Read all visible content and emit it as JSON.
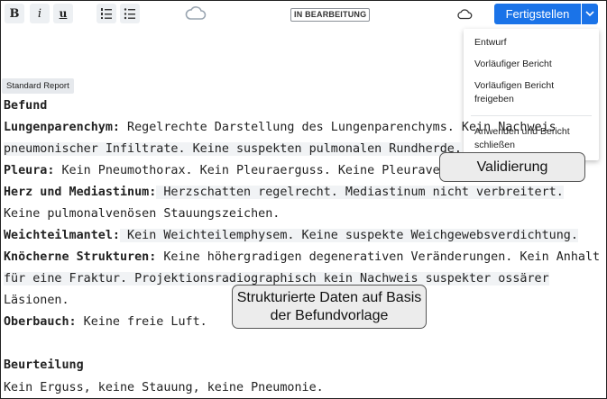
{
  "toolbar": {
    "bold_label": "B",
    "italic_label": "i",
    "underline_label": "u",
    "status": "IN BEARBEITUNG",
    "finish_label": "Fertigstellen"
  },
  "menu": {
    "items": [
      {
        "label": "Entwurf"
      },
      {
        "label": "Vorläufiger Bericht"
      },
      {
        "label": "Vorläufigen Bericht freigeben"
      },
      {
        "label": "Anwenden und Bericht schließen"
      }
    ]
  },
  "template_tag": "Standard Report",
  "report": {
    "findings_heading": "Befund",
    "lung_label": "Lungenparenchym:",
    "lung_text_1": " Regelrechte Darstellung des Lungenparenchyms. Kein Nachweis",
    "lung_text_2": "pneumonischer Infiltrate. Keine suspekten pulmonalen Rundherde.",
    "pleura_label": "Pleura:",
    "pleura_text": " Kein Pneumothorax. Kein Pleuraerguss. Keine Pleuraverdickung.",
    "heart_label": "Herz und Mediastinum:",
    "heart_text_1": " Herzschatten regelrecht. Mediastinum nicht verbreitert.",
    "heart_text_2": "Keine pulmonalvenösen Stauungszeichen.",
    "soft_label": "Weichteilmantel:",
    "soft_text": " Kein Weichteilemphysem. Keine suspekte Weichgewebsverdichtung.",
    "bone_label": "Knöcherne Strukturen:",
    "bone_text_1": " Keine höhergradigen degenerativen Veränderungen. Kein Anhalt",
    "bone_text_2": "für eine Fraktur. Projektionsradiographisch kein Nachweis suspekter ossärer",
    "bone_text_3": "Läsionen.",
    "abdomen_label": "Oberbauch:",
    "abdomen_text": " Keine freie Luft.",
    "assessment_heading": "Beurteilung",
    "assessment_text": "Kein Erguss, keine Stauung, keine Pneumonie."
  },
  "callouts": {
    "validation": "Validierung",
    "structured": "Strukturierte Daten auf Basis der Befundvorlage"
  },
  "colors": {
    "accent": "#1a73e8",
    "toolbar_button_bg": "#edf0f3",
    "callout_bg": "#ececec"
  }
}
